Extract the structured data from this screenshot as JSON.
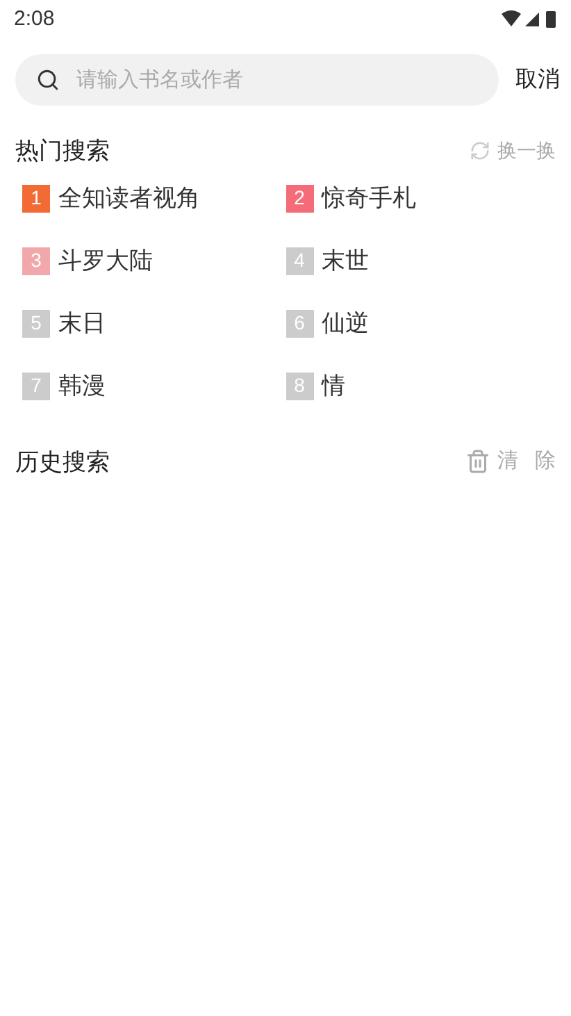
{
  "status_bar": {
    "time": "2:08"
  },
  "search": {
    "placeholder": "请输入书名或作者",
    "cancel": "取消"
  },
  "hot": {
    "title": "热门搜索",
    "refresh": "换一换",
    "items": [
      {
        "rank": "1",
        "title": "全知读者视角",
        "color": "#f26b35"
      },
      {
        "rank": "2",
        "title": "惊奇手札",
        "color": "#f56c78"
      },
      {
        "rank": "3",
        "title": "斗罗大陆",
        "color": "#f2a7ab"
      },
      {
        "rank": "4",
        "title": "末世",
        "color": "#cccccc"
      },
      {
        "rank": "5",
        "title": "末日",
        "color": "#cccccc"
      },
      {
        "rank": "6",
        "title": "仙逆",
        "color": "#cccccc"
      },
      {
        "rank": "7",
        "title": "韩漫",
        "color": "#cccccc"
      },
      {
        "rank": "8",
        "title": "情",
        "color": "#cccccc"
      }
    ]
  },
  "history": {
    "title": "历史搜索",
    "clear": "清除"
  }
}
